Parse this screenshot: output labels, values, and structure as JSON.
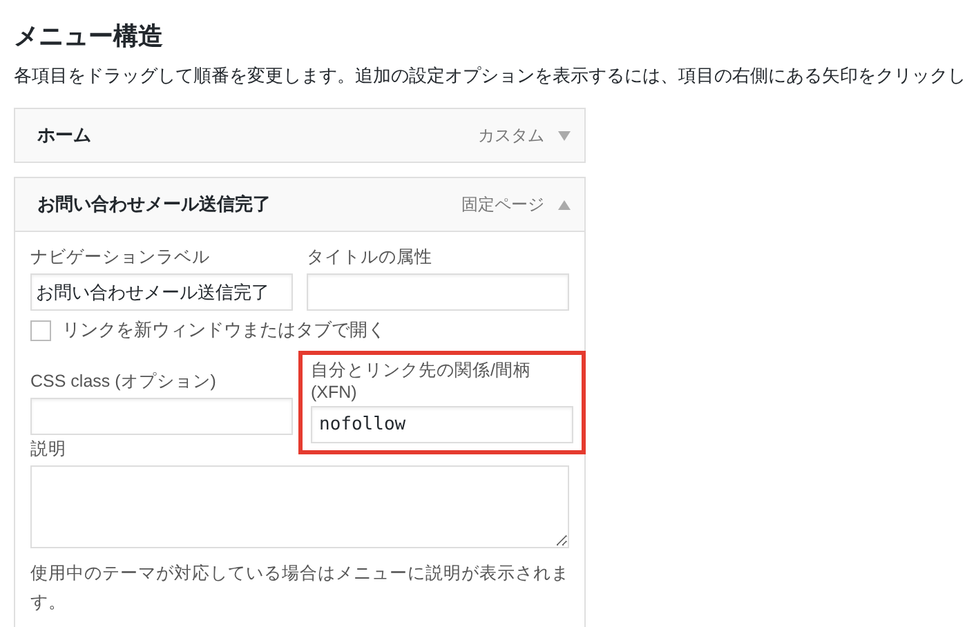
{
  "heading": "メニュー構造",
  "instructions": "各項目をドラッグして順番を変更します。追加の設定オプションを表示するには、項目の右側にある矢印をクリックし",
  "menu_items": [
    {
      "title": "ホーム",
      "type_label": "カスタム",
      "expanded": false
    },
    {
      "title": "お問い合わせメール送信完了",
      "type_label": "固定ページ",
      "expanded": true,
      "settings": {
        "navigation_label": {
          "label": "ナビゲーションラベル",
          "value": "お問い合わせメール送信完了"
        },
        "title_attribute": {
          "label": "タイトルの属性"
        },
        "new_window": {
          "label": "リンクを新ウィンドウまたはタブで開く",
          "checked": false
        },
        "css_class": {
          "label": "CSS class (オプション)"
        },
        "xfn": {
          "label": "自分とリンク先の関係/間柄 (XFN)",
          "value": "nofollow",
          "highlighted": true
        },
        "description": {
          "label": "説明",
          "help": "使用中のテーマが対応している場合はメニューに説明が表示されます。"
        }
      }
    }
  ]
}
